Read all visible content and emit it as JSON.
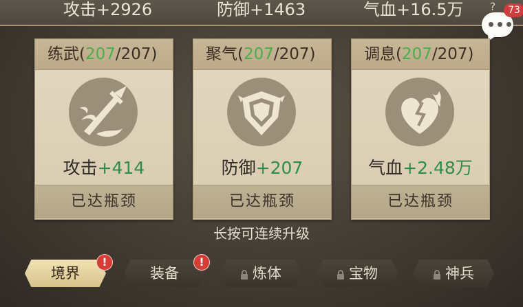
{
  "top_stats": [
    "攻击+2926",
    "防御+1463",
    "气血+16.5万"
  ],
  "help_label": "?",
  "chat_badge": "73",
  "cards": [
    {
      "name": "练武",
      "current": "207",
      "max": "207",
      "stat_name": "攻击",
      "stat_bonus": "+414",
      "button": "已达瓶颈",
      "icon": "sword-icon"
    },
    {
      "name": "聚气",
      "current": "207",
      "max": "207",
      "stat_name": "防御",
      "stat_bonus": "+207",
      "button": "已达瓶颈",
      "icon": "shield-icon"
    },
    {
      "name": "调息",
      "current": "207",
      "max": "207",
      "stat_name": "气血",
      "stat_bonus": "+2.48万",
      "button": "已达瓶颈",
      "icon": "heart-flame-icon"
    }
  ],
  "hint": "长按可连续升级",
  "tabs": [
    {
      "label": "境界",
      "active": true,
      "locked": false,
      "alert": "!"
    },
    {
      "label": "装备",
      "active": false,
      "locked": false,
      "alert": "!"
    },
    {
      "label": "炼体",
      "active": false,
      "locked": true
    },
    {
      "label": "宝物",
      "active": false,
      "locked": true
    },
    {
      "label": "神兵",
      "active": false,
      "locked": true
    }
  ],
  "colors": {
    "accent_green": "#46b04b",
    "alert_red": "#d73d35",
    "active_tab": "#e6d39f"
  }
}
